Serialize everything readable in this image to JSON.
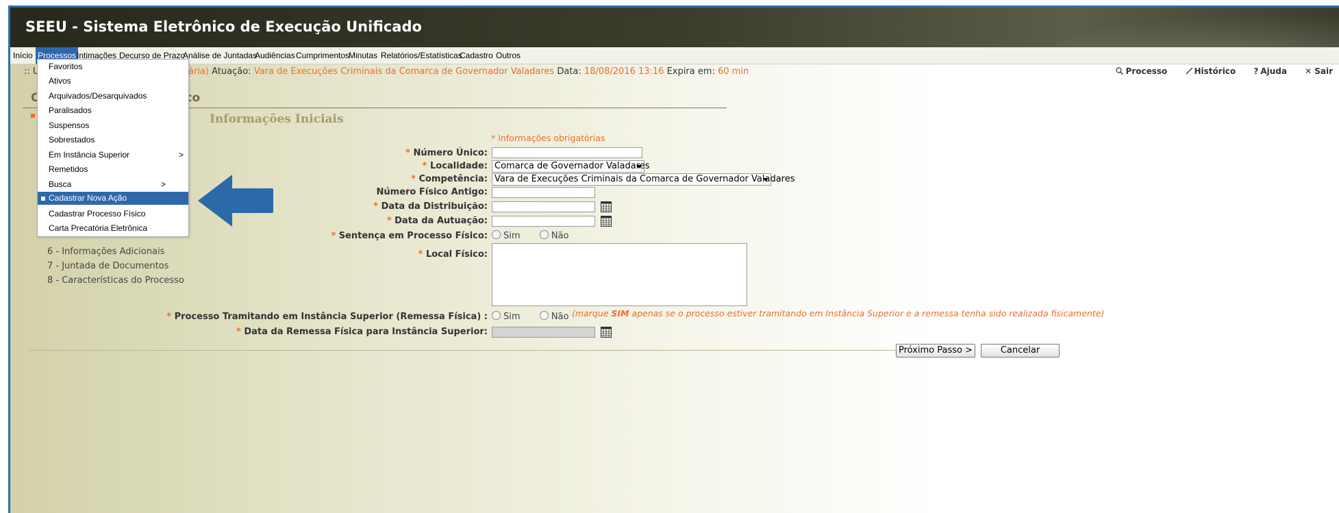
{
  "app": {
    "title": "SEEU - Sistema Eletrônico de Execução Unificado"
  },
  "menu": [
    {
      "label": "Início"
    },
    {
      "label": "Processos",
      "active": true
    },
    {
      "label": "Intimações"
    },
    {
      "label": "Decurso de Prazo"
    },
    {
      "label": "Análise de Juntadas"
    },
    {
      "label": "Audiências"
    },
    {
      "label": "Cumprimentos"
    },
    {
      "label": "Minutas"
    },
    {
      "label": "Relatórios/Estatísticas"
    },
    {
      "label": "Cadastro"
    },
    {
      "label": "Outros"
    }
  ],
  "infobar": {
    "prefix": ":: U",
    "role_tail": "iária)",
    "atuacao_label": "Atuação:",
    "atuacao_value": "Vara de Execuções Criminais da Comarca de Governador Valadares",
    "data_label": "Data:",
    "data_value": "18/08/2016 13:16",
    "expira_label": "Expira em:",
    "expira_value": "60 min"
  },
  "toplinks": {
    "processo": "Processo",
    "historico": "Histórico",
    "ajuda": "Ajuda",
    "sair": "Sair"
  },
  "page": {
    "heading_start": "C",
    "heading_end": "co"
  },
  "section_title": "Informações Iniciais",
  "required_note": "* Informações obrigatórias",
  "dropdown": {
    "items": [
      {
        "label": "Favoritos"
      },
      {
        "label": "Ativos"
      },
      {
        "label": "Arquivados/Desarquivados"
      },
      {
        "label": "Paralisados"
      },
      {
        "label": "Suspensos"
      },
      {
        "label": "Sobrestados"
      },
      {
        "label": "Em Instância Superior",
        "submenu": ">"
      },
      {
        "label": "Remetidos"
      },
      {
        "label": "Busca",
        "submenu": ">"
      },
      {
        "label": "Cadastrar Nova Ação",
        "highlighted": true
      },
      {
        "label": "Cadastrar Processo Físico"
      },
      {
        "label": "Carta Precatória Eletrônica"
      }
    ]
  },
  "steps": [
    "6 - Informações Adicionais",
    "7 - Juntada de Documentos",
    "8 - Características do Processo"
  ],
  "form": {
    "numero_unico": {
      "label": "Número Único:",
      "value": ""
    },
    "localidade": {
      "label": "Localidade:",
      "value": "Comarca de Governador Valadares"
    },
    "competencia": {
      "label": "Competência:",
      "value": "Vara de Execuções Criminais da Comarca de Governador Valadares"
    },
    "numero_fisico": {
      "label": "Número Físico Antigo:",
      "value": ""
    },
    "data_distribuicao": {
      "label": "Data da Distribuição:",
      "value": ""
    },
    "data_autuacao": {
      "label": "Data da Autuação:",
      "value": ""
    },
    "sentenca": {
      "label": "Sentença em Processo Físico:",
      "opt_sim": "Sim",
      "opt_nao": "Não"
    },
    "local_fisico": {
      "label": "Local Físico:",
      "value": ""
    },
    "tramitando": {
      "label": "Processo Tramitando em Instância Superior (Remessa Física) :",
      "opt_sim": "Sim",
      "opt_nao": "Não"
    },
    "tramitando_note": {
      "pre": "(marque ",
      "bold": "SIM",
      "post": " apenas se o processo estiver tramitando em Instância Superior e a remessa tenha sido realizada fisicamente)"
    },
    "data_remessa": {
      "label": "Data da Remessa Física para Instância Superior:",
      "value": ""
    }
  },
  "buttons": {
    "proximo": "Próximo Passo >",
    "cancelar": "Cancelar"
  },
  "colors": {
    "accent": "#2e68aa",
    "required": "#ee6d2a",
    "titlebar": "#26291c",
    "arrow": "#2b6aa8"
  }
}
